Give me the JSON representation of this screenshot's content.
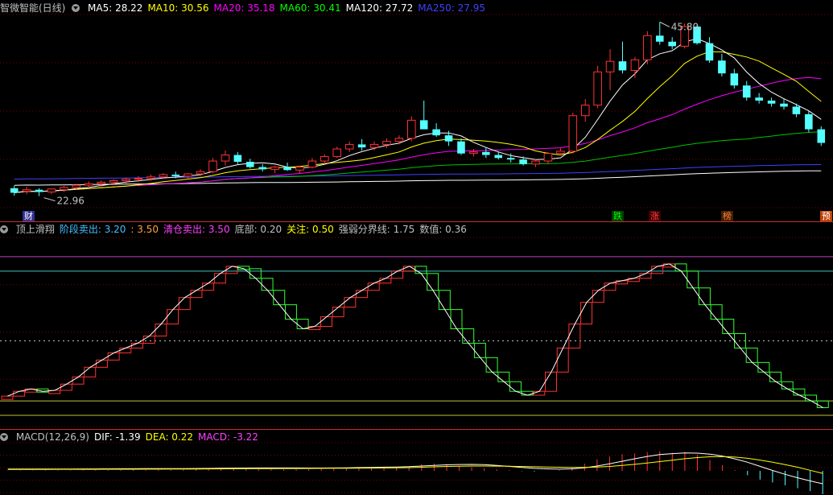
{
  "panel1": {
    "title": "智微智能(日线)",
    "ma": [
      {
        "label": "MA5: 28.22",
        "color": "#ffffff"
      },
      {
        "label": "MA10: 30.56",
        "color": "#ffff00"
      },
      {
        "label": "MA20: 35.18",
        "color": "#ff00ff"
      },
      {
        "label": "MA60: 30.41",
        "color": "#00ff00"
      },
      {
        "label": "MA120: 27.72",
        "color": "#ffffff"
      },
      {
        "label": "MA250: 27.95",
        "color": "#4040ff"
      }
    ],
    "high_label": "45.80",
    "low_label": "22.96",
    "tags": [
      {
        "text": "财",
        "color": "#ffffff",
        "bg": "#303090"
      },
      {
        "text": "跌",
        "color": "#00ff00",
        "bg": "#004000"
      },
      {
        "text": "涨",
        "color": "#ff4040",
        "bg": "#400000"
      },
      {
        "text": "榜",
        "color": "#ff8040",
        "bg": "#402000"
      },
      {
        "text": "预",
        "color": "#ffffff",
        "bg": "#c04000"
      }
    ]
  },
  "panel2": {
    "items": [
      {
        "label": "顶上滑翔",
        "color": "#c0c0c0"
      },
      {
        "label": "阶段卖出: 3.20",
        "color": "#40c0ff"
      },
      {
        "label": ": 3.50",
        "color": "#ffa040"
      },
      {
        "label": "清仓卖出: 3.50",
        "color": "#ff40ff"
      },
      {
        "label": "底部: 0.20",
        "color": "#c0c0c0"
      },
      {
        "label": "关注: 0.50",
        "color": "#ffff00"
      },
      {
        "label": "强弱分界线: 1.75",
        "color": "#c0c0c0"
      },
      {
        "label": "数值: 0.36",
        "color": "#c0c0c0"
      }
    ]
  },
  "panel3": {
    "items": [
      {
        "label": "MACD(12,26,9)",
        "color": "#c0c0c0"
      },
      {
        "label": "DIF: -1.39",
        "color": "#ffffff"
      },
      {
        "label": "DEA: 0.22",
        "color": "#ffff00"
      },
      {
        "label": "MACD: -3.22",
        "color": "#ff40ff"
      }
    ]
  },
  "chart_data": [
    {
      "type": "candlestick",
      "title": "智微智能(日线)",
      "annotations": [
        "45.80",
        "22.96"
      ],
      "ohlc": [
        [
          24.0,
          24.3,
          23.0,
          23.4
        ],
        [
          23.6,
          24.2,
          23.2,
          23.8
        ],
        [
          23.8,
          24.0,
          22.96,
          23.5
        ],
        [
          23.5,
          24.0,
          23.2,
          23.9
        ],
        [
          23.8,
          24.3,
          23.5,
          24.1
        ],
        [
          24.1,
          24.6,
          23.8,
          24.4
        ],
        [
          24.4,
          24.9,
          24.0,
          24.6
        ],
        [
          24.6,
          25.0,
          24.2,
          24.8
        ],
        [
          24.8,
          25.2,
          24.4,
          25.0
        ],
        [
          25.0,
          25.4,
          24.6,
          25.2
        ],
        [
          25.2,
          25.6,
          24.8,
          25.3
        ],
        [
          25.3,
          25.8,
          25.0,
          25.5
        ],
        [
          25.5,
          26.0,
          25.2,
          25.8
        ],
        [
          25.8,
          26.2,
          25.3,
          25.6
        ],
        [
          25.6,
          26.0,
          25.2,
          25.9
        ],
        [
          25.9,
          26.5,
          25.6,
          26.2
        ],
        [
          26.2,
          28.0,
          26.0,
          27.6
        ],
        [
          27.6,
          29.0,
          27.0,
          28.4
        ],
        [
          28.4,
          28.8,
          27.2,
          27.5
        ],
        [
          27.5,
          27.9,
          26.6,
          26.8
        ],
        [
          26.8,
          27.2,
          26.2,
          26.5
        ],
        [
          26.5,
          27.0,
          26.0,
          26.8
        ],
        [
          26.8,
          27.4,
          26.3,
          26.4
        ],
        [
          26.4,
          27.0,
          26.0,
          26.8
        ],
        [
          26.8,
          28.0,
          26.6,
          27.6
        ],
        [
          27.6,
          28.5,
          27.2,
          28.2
        ],
        [
          28.2,
          29.5,
          28.0,
          29.2
        ],
        [
          29.2,
          30.2,
          28.8,
          29.8
        ],
        [
          29.8,
          30.5,
          29.0,
          29.4
        ],
        [
          29.4,
          30.2,
          29.0,
          29.8
        ],
        [
          29.8,
          30.6,
          29.3,
          30.2
        ],
        [
          30.2,
          31.0,
          29.8,
          30.6
        ],
        [
          30.6,
          33.5,
          30.2,
          33.0
        ],
        [
          33.0,
          35.6,
          32.5,
          31.8
        ],
        [
          31.8,
          32.6,
          30.8,
          31.0
        ],
        [
          31.0,
          31.6,
          29.6,
          30.2
        ],
        [
          30.2,
          30.6,
          28.4,
          28.6
        ],
        [
          28.6,
          29.2,
          28.2,
          28.8
        ],
        [
          28.8,
          29.4,
          28.0,
          28.4
        ],
        [
          28.4,
          28.9,
          27.8,
          28.0
        ],
        [
          28.0,
          28.6,
          27.4,
          27.8
        ],
        [
          27.8,
          28.2,
          27.0,
          27.2
        ],
        [
          27.2,
          27.9,
          26.8,
          27.6
        ],
        [
          27.6,
          28.8,
          27.2,
          28.6
        ],
        [
          28.6,
          29.3,
          28.3,
          28.9
        ],
        [
          28.9,
          34.0,
          28.6,
          33.6
        ],
        [
          33.6,
          35.8,
          32.8,
          35.0
        ],
        [
          35.0,
          40.2,
          34.6,
          39.4
        ],
        [
          39.4,
          42.4,
          37.0,
          40.8
        ],
        [
          40.8,
          43.4,
          39.2,
          39.6
        ],
        [
          39.6,
          41.4,
          38.6,
          41.0
        ],
        [
          41.0,
          44.8,
          40.4,
          44.2
        ],
        [
          44.2,
          46.0,
          43.0,
          43.4
        ],
        [
          43.4,
          44.0,
          42.4,
          42.8
        ],
        [
          42.8,
          45.8,
          42.5,
          45.4
        ],
        [
          45.4,
          45.6,
          43.0,
          43.2
        ],
        [
          43.2,
          44.0,
          40.6,
          40.9
        ],
        [
          40.9,
          41.8,
          38.8,
          39.2
        ],
        [
          39.2,
          39.8,
          37.2,
          37.6
        ],
        [
          37.6,
          38.2,
          35.6,
          36.0
        ],
        [
          36.0,
          36.6,
          35.2,
          35.6
        ],
        [
          35.6,
          36.0,
          34.8,
          35.2
        ],
        [
          35.2,
          35.8,
          34.4,
          34.8
        ],
        [
          34.8,
          35.2,
          33.4,
          33.8
        ],
        [
          33.8,
          34.2,
          31.4,
          31.8
        ],
        [
          31.8,
          32.2,
          29.6,
          30.0
        ]
      ]
    },
    {
      "type": "line",
      "title": "顶上滑翔",
      "series": [
        {
          "name": "数值",
          "values": [
            0.6,
            0.7,
            0.75,
            0.7,
            0.72,
            0.85,
            1.0,
            1.2,
            1.35,
            1.5,
            1.6,
            1.7,
            1.85,
            2.1,
            2.4,
            2.65,
            2.8,
            2.95,
            3.15,
            3.3,
            3.25,
            3.05,
            2.8,
            2.5,
            2.2,
            2.0,
            2.05,
            2.25,
            2.45,
            2.65,
            2.8,
            2.95,
            3.05,
            3.2,
            3.3,
            3.15,
            2.8,
            2.4,
            2.0,
            1.7,
            1.4,
            1.1,
            0.9,
            0.7,
            0.62,
            0.7,
            1.1,
            1.6,
            2.1,
            2.55,
            2.8,
            2.95,
            3.0,
            3.05,
            3.15,
            3.3,
            3.35,
            3.2,
            2.85,
            2.5,
            2.2,
            1.9,
            1.6,
            1.3,
            1.1,
            0.9,
            0.75,
            0.62,
            0.5,
            0.36
          ]
        }
      ],
      "thresholds": [
        3.2,
        3.5,
        0.2,
        0.5,
        1.75
      ]
    },
    {
      "type": "bar",
      "title": "MACD(12,26,9)",
      "series": [
        {
          "name": "MACD",
          "values": [
            0.05,
            0.06,
            0.06,
            0.07,
            0.08,
            0.08,
            0.09,
            0.1,
            0.1,
            0.11,
            0.12,
            0.12,
            0.13,
            0.14,
            0.15,
            0.16,
            0.2,
            0.25,
            0.26,
            0.24,
            0.22,
            0.2,
            0.19,
            0.2,
            0.22,
            0.26,
            0.3,
            0.34,
            0.36,
            0.38,
            0.4,
            0.45,
            0.6,
            0.9,
            1.0,
            0.9,
            0.7,
            0.5,
            0.35,
            0.2,
            0.1,
            -0.05,
            -0.1,
            0.0,
            0.1,
            0.5,
            1.0,
            1.6,
            2.0,
            2.3,
            2.4,
            2.6,
            2.7,
            2.5,
            2.6,
            2.2,
            1.5,
            0.8,
            0.1,
            -0.6,
            -1.2,
            -1.6,
            -2.0,
            -2.4,
            -2.8,
            -3.22
          ]
        }
      ]
    }
  ],
  "colors": {
    "up": "#ff3232",
    "down": "#54ffff",
    "grid": "#7a0000",
    "border": "#b02020"
  }
}
